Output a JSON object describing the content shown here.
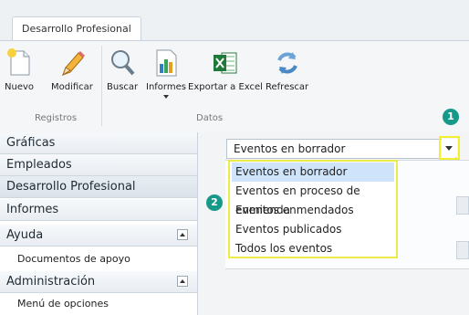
{
  "ribbon": {
    "tab": "Desarrollo Profesional",
    "tools": [
      "Nuevo",
      "Modificar",
      "Buscar",
      "Informes",
      "Exportar a Excel",
      "Refrescar"
    ],
    "groups": [
      "Registros",
      "Datos"
    ]
  },
  "sidebar": {
    "items": [
      "Gráficas",
      "Empleados",
      "Desarrollo Profesional",
      "Informes",
      "Ayuda",
      "Administración"
    ],
    "sub_ayuda": "Documentos de apoyo",
    "sub_admin": "Menú de opciones"
  },
  "filter": {
    "value": "Eventos en borrador",
    "options": [
      "Eventos en borrador",
      "Eventos en proceso de enmienda",
      "Eventos enmendados",
      "Eventos publicados",
      "Todos los eventos"
    ]
  },
  "badges": [
    "1",
    "2"
  ],
  "colors": {
    "highlight": "#f3ef2a",
    "badge": "#17998a",
    "selected": "#cfe4fb"
  }
}
